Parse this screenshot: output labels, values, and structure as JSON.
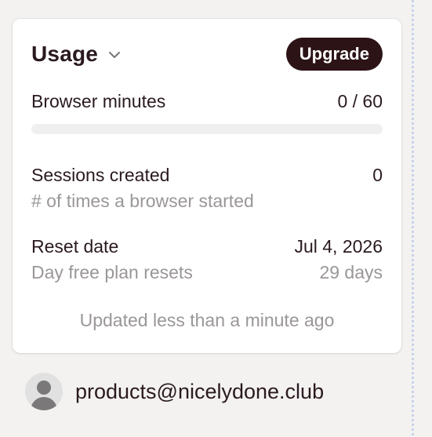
{
  "usage_card": {
    "title": "Usage",
    "upgrade_label": "Upgrade",
    "browser_minutes": {
      "label": "Browser minutes",
      "value": "0 / 60",
      "progress_fraction": 0
    },
    "sessions": {
      "label": "Sessions created",
      "value": "0",
      "description": "# of times a browser started"
    },
    "reset": {
      "label": "Reset date",
      "value": "Jul 4, 2026",
      "description": "Day free plan resets",
      "days_remaining": "29 days"
    },
    "updated_note": "Updated less than a minute ago"
  },
  "account": {
    "email": "products@nicelydone.club",
    "avatar_icon": "user-silhouette-icon"
  },
  "colors": {
    "page_background": "#f3f2f1",
    "card_background": "#ffffff",
    "primary_text": "#2a1a1f",
    "muted_text": "#9a9699",
    "button_background": "#2b1316",
    "progress_track": "#f0efef"
  }
}
